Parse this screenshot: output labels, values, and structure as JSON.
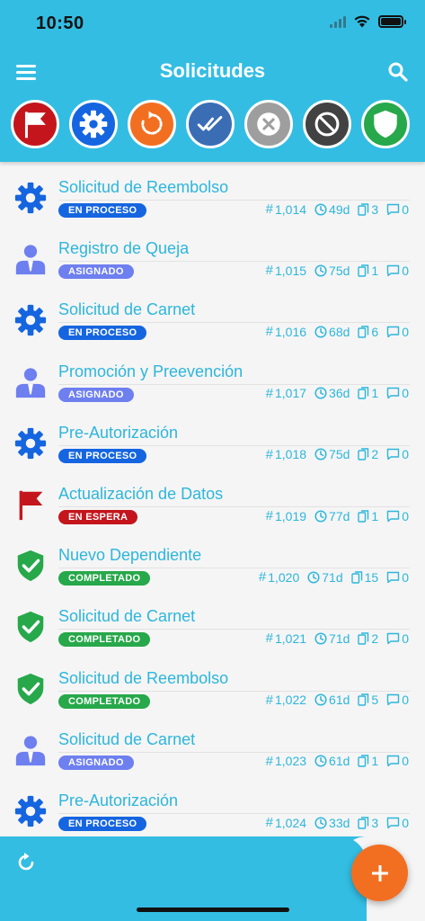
{
  "status": {
    "time": "10:50"
  },
  "nav": {
    "title": "Solicitudes"
  },
  "colors": {
    "header": "#33bde3",
    "accent": "#2db6dc",
    "en_proceso": "#1565e0",
    "asignado": "#6e7ff0",
    "en_espera": "#c4151c",
    "completado": "#27a84a",
    "fab": "#f26f21"
  },
  "filters": [
    {
      "icon": "flag-icon",
      "color": "#c4151c"
    },
    {
      "icon": "gear-icon",
      "color": "#1565e0"
    },
    {
      "icon": "rotate-icon",
      "color": "#f26f21"
    },
    {
      "icon": "double-check-icon",
      "color": "#3b6db5"
    },
    {
      "icon": "close-circle-icon",
      "color": "#9e9e9e"
    },
    {
      "icon": "block-icon",
      "color": "#424242"
    },
    {
      "icon": "shield-check-icon",
      "color": "#27a84a"
    }
  ],
  "requests": [
    {
      "title": "Solicitud de Reembolso",
      "status": "EN PROCESO",
      "icon": "gear-icon",
      "id": "1,014",
      "days": "49d",
      "docs": "3",
      "comments": "0"
    },
    {
      "title": "Registro de Queja",
      "status": "ASIGNADO",
      "icon": "user-icon",
      "id": "1,015",
      "days": "75d",
      "docs": "1",
      "comments": "0"
    },
    {
      "title": "Solicitud de Carnet",
      "status": "EN PROCESO",
      "icon": "gear-icon",
      "id": "1,016",
      "days": "68d",
      "docs": "6",
      "comments": "0"
    },
    {
      "title": "Promoción y Preevención",
      "status": "ASIGNADO",
      "icon": "user-icon",
      "id": "1,017",
      "days": "36d",
      "docs": "1",
      "comments": "0"
    },
    {
      "title": "Pre-Autorización",
      "status": "EN PROCESO",
      "icon": "gear-icon",
      "id": "1,018",
      "days": "75d",
      "docs": "2",
      "comments": "0"
    },
    {
      "title": "Actualización de Datos",
      "status": "EN ESPERA",
      "icon": "flag-icon",
      "id": "1,019",
      "days": "77d",
      "docs": "1",
      "comments": "0"
    },
    {
      "title": "Nuevo Dependiente",
      "status": "COMPLETADO",
      "icon": "shield-check-icon",
      "id": "1,020",
      "days": "71d",
      "docs": "15",
      "comments": "0"
    },
    {
      "title": "Solicitud de Carnet",
      "status": "COMPLETADO",
      "icon": "shield-check-icon",
      "id": "1,021",
      "days": "71d",
      "docs": "2",
      "comments": "0"
    },
    {
      "title": "Solicitud de Reembolso",
      "status": "COMPLETADO",
      "icon": "shield-check-icon",
      "id": "1,022",
      "days": "61d",
      "docs": "5",
      "comments": "0"
    },
    {
      "title": "Solicitud de Carnet",
      "status": "ASIGNADO",
      "icon": "user-icon",
      "id": "1,023",
      "days": "61d",
      "docs": "1",
      "comments": "0"
    },
    {
      "title": "Pre-Autorización",
      "status": "EN PROCESO",
      "icon": "gear-icon",
      "id": "1,024",
      "days": "33d",
      "docs": "3",
      "comments": "0"
    }
  ]
}
